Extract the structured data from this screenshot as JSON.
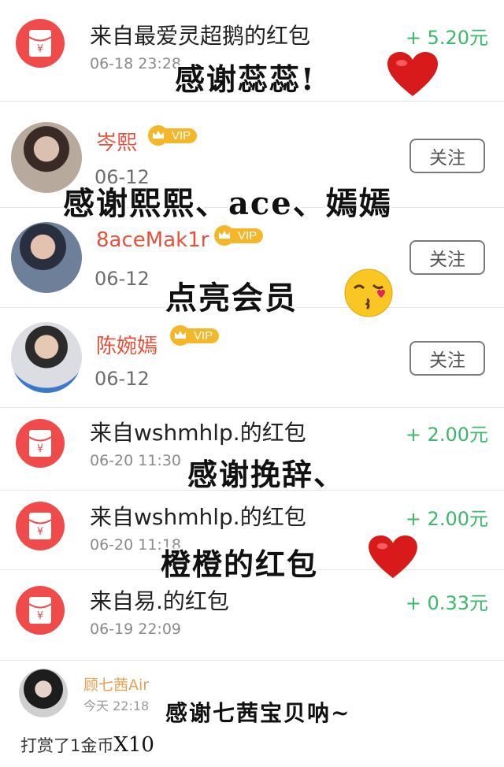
{
  "packets": [
    {
      "title": "来自最爱灵超鹅的红包",
      "time": "06-18 23:28",
      "amount": "+ 5.20元"
    },
    {
      "title": "来自wshmhlp.的红包",
      "time": "06-20 11:30",
      "amount": "+ 2.00元"
    },
    {
      "title": "来自wshmhlp.的红包",
      "time": "06-20 11:18",
      "amount": "+ 2.00元"
    },
    {
      "title": "来自易.的红包",
      "time": "06-19 22:09",
      "amount": "+ 0.33元"
    }
  ],
  "members": [
    {
      "name": "岑熙",
      "vip": "VIP",
      "date": "06-12",
      "follow": "关注"
    },
    {
      "name": "8aceMak1r",
      "vip": "VIP",
      "date": "06-12",
      "follow": "关注"
    },
    {
      "name": "陈婉嫣",
      "vip": "VIP",
      "date": "06-12",
      "follow": "关注"
    }
  ],
  "gift": {
    "name": "顾七茜Air",
    "time": "今天 22:18",
    "text": "打赏了1金币",
    "multiplier": "X10"
  },
  "captions": {
    "c1": "感谢蕊蕊!",
    "c2": "感谢熙熙、ace、嫣嫣",
    "c3": "点亮会员",
    "c4": "感谢挽辞、",
    "c5": "橙橙的红包",
    "c6": "感谢七茜宝贝呐~"
  },
  "colors": {
    "red_packet": "#f04a4a",
    "amount": "#3ab96a",
    "username": "#e8503a",
    "vip": "#f5b72a"
  }
}
